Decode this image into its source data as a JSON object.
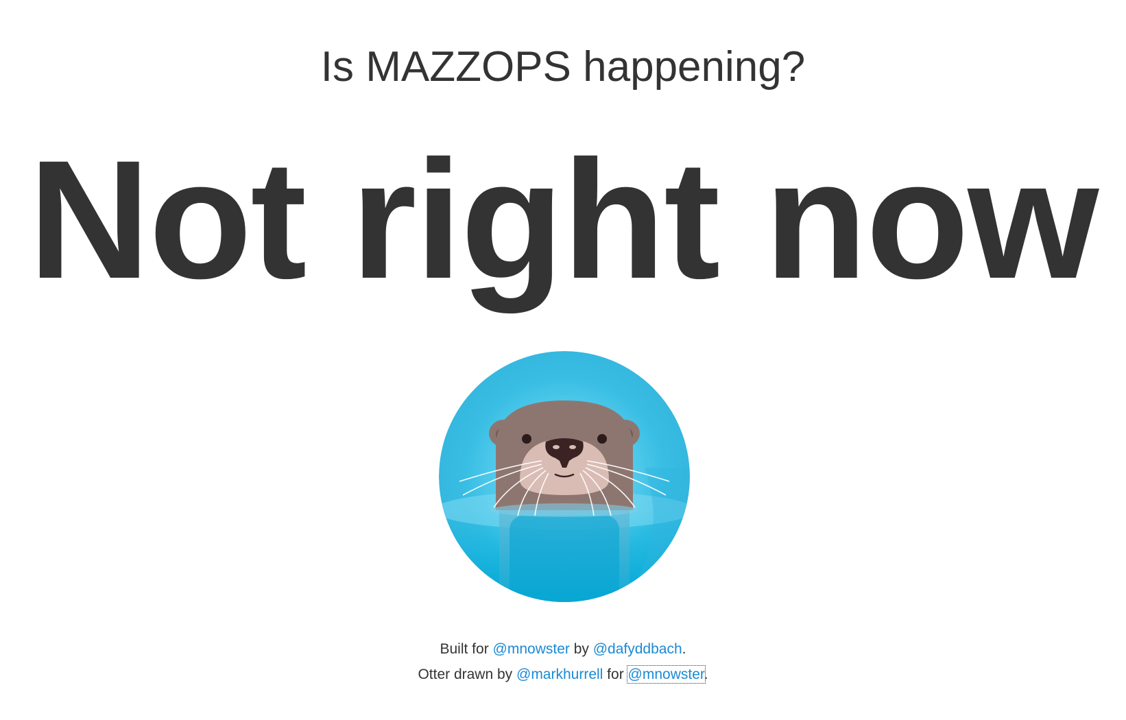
{
  "header": {
    "question": "Is MAZZOPS happening?"
  },
  "status": {
    "answer": "Not right now"
  },
  "image": {
    "icon": "otter-icon",
    "colors": {
      "water_light": "#6fd3f0",
      "water_mid": "#38bde3",
      "water_deep": "#00a6d6",
      "fur": "#8e7670",
      "muzzle": "#d9bcb4",
      "nose": "#3a2322"
    }
  },
  "footer": {
    "line1": {
      "prefix": "Built for ",
      "link1": "@mnowster",
      "middle": " by ",
      "link2": "@dafyddbach",
      "suffix": "."
    },
    "line2": {
      "prefix": "Otter drawn by ",
      "link1": "@markhurrell",
      "middle": " for ",
      "link2": "@mnowster",
      "suffix": "."
    },
    "link_color": "#1a8ad4"
  }
}
